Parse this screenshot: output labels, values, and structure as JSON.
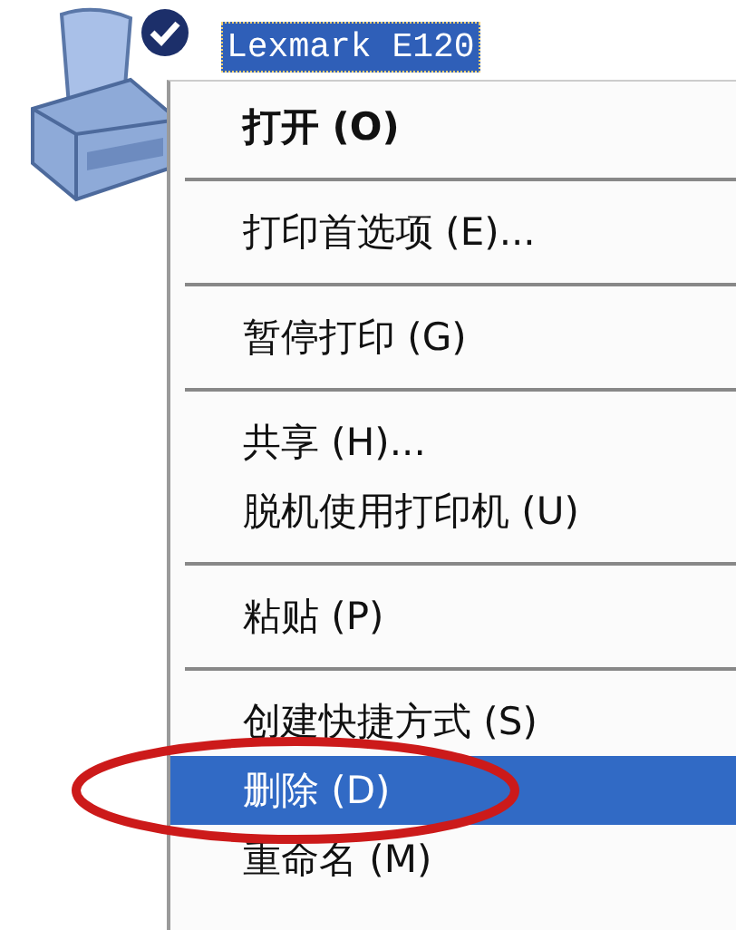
{
  "desktop_icon": {
    "label": "Lexmark  E120",
    "selected": true,
    "default_printer": true
  },
  "context_menu": {
    "items": [
      {
        "kind": "item",
        "label": "打开 (O)",
        "default": true,
        "selected": false,
        "circled": false
      },
      {
        "kind": "separator"
      },
      {
        "kind": "item",
        "label": "打印首选项 (E)...",
        "default": false,
        "selected": false,
        "circled": false
      },
      {
        "kind": "separator"
      },
      {
        "kind": "item",
        "label": "暂停打印 (G)",
        "default": false,
        "selected": false,
        "circled": false
      },
      {
        "kind": "separator"
      },
      {
        "kind": "item",
        "label": "共享 (H)...",
        "default": false,
        "selected": false,
        "circled": false
      },
      {
        "kind": "item",
        "label": "脱机使用打印机 (U)",
        "default": false,
        "selected": false,
        "circled": false
      },
      {
        "kind": "separator"
      },
      {
        "kind": "item",
        "label": "粘贴 (P)",
        "default": false,
        "selected": false,
        "circled": false
      },
      {
        "kind": "separator"
      },
      {
        "kind": "item",
        "label": "创建快捷方式 (S)",
        "default": false,
        "selected": false,
        "circled": false
      },
      {
        "kind": "item",
        "label": "删除 (D)",
        "default": false,
        "selected": true,
        "circled": true
      },
      {
        "kind": "item",
        "label": "重命名 (M)",
        "default": false,
        "selected": false,
        "circled": false
      }
    ]
  },
  "annotation": {
    "color": "#cc1a1a"
  }
}
